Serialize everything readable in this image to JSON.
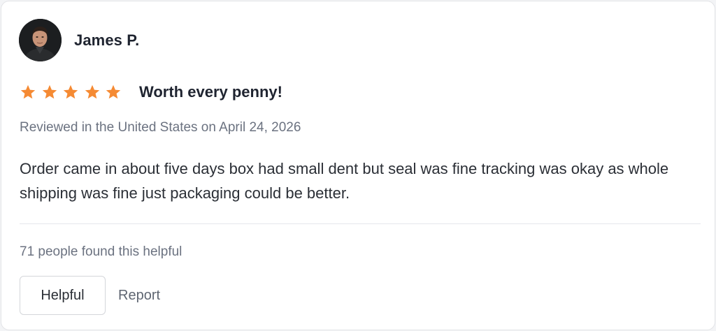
{
  "review": {
    "reviewer_name": "James P.",
    "avatar_icon": "user-avatar-photo",
    "rating": 5,
    "max_rating": 5,
    "star_color": "#f58a33",
    "title": "Worth every penny!",
    "date_line": "Reviewed in the United States on April 24, 2026",
    "body": "Order came in about five days box had small dent but seal was fine tracking was okay as whole shipping was fine just packaging could be better.",
    "helpful_count_text": "71 people found this helpful"
  },
  "actions": {
    "helpful_label": "Helpful",
    "report_label": "Report"
  }
}
